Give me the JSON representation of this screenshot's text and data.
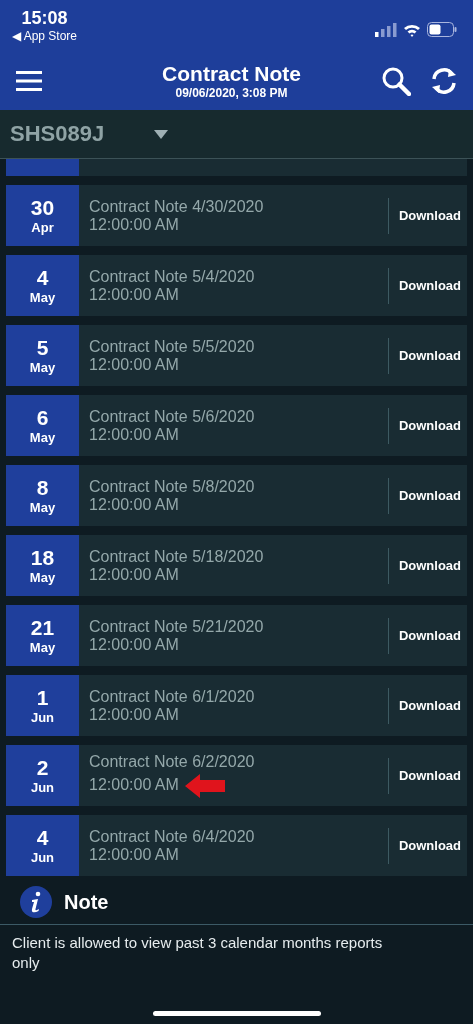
{
  "status_bar": {
    "time": "15:08",
    "back_label": "◀ App Store"
  },
  "header": {
    "title": "Contract Note",
    "subtitle": "09/06/2020, 3:08 PM"
  },
  "account_dropdown": {
    "value": "SHS089J"
  },
  "notes": [
    {
      "day": "30",
      "month": "Apr",
      "title": "Contract Note 4/30/2020",
      "time": "12:00:00 AM",
      "action": "Download",
      "marked": false
    },
    {
      "day": "4",
      "month": "May",
      "title": "Contract Note 5/4/2020",
      "time": "12:00:00 AM",
      "action": "Download",
      "marked": false
    },
    {
      "day": "5",
      "month": "May",
      "title": "Contract Note 5/5/2020",
      "time": "12:00:00 AM",
      "action": "Download",
      "marked": false
    },
    {
      "day": "6",
      "month": "May",
      "title": "Contract Note 5/6/2020",
      "time": "12:00:00 AM",
      "action": "Download",
      "marked": false
    },
    {
      "day": "8",
      "month": "May",
      "title": "Contract Note 5/8/2020",
      "time": "12:00:00 AM",
      "action": "Download",
      "marked": false
    },
    {
      "day": "18",
      "month": "May",
      "title": "Contract Note 5/18/2020",
      "time": "12:00:00 AM",
      "action": "Download",
      "marked": false
    },
    {
      "day": "21",
      "month": "May",
      "title": "Contract Note 5/21/2020",
      "time": "12:00:00 AM",
      "action": "Download",
      "marked": false
    },
    {
      "day": "1",
      "month": "Jun",
      "title": "Contract Note 6/1/2020",
      "time": "12:00:00 AM",
      "action": "Download",
      "marked": false
    },
    {
      "day": "2",
      "month": "Jun",
      "title": "Contract Note 6/2/2020",
      "time": "12:00:00 AM",
      "action": "Download",
      "marked": true
    },
    {
      "day": "4",
      "month": "Jun",
      "title": "Contract Note 6/4/2020",
      "time": "12:00:00 AM",
      "action": "Download",
      "marked": false
    }
  ],
  "note": {
    "heading": "Note",
    "text": "Client is allowed to view past 3 calendar months reports only"
  }
}
